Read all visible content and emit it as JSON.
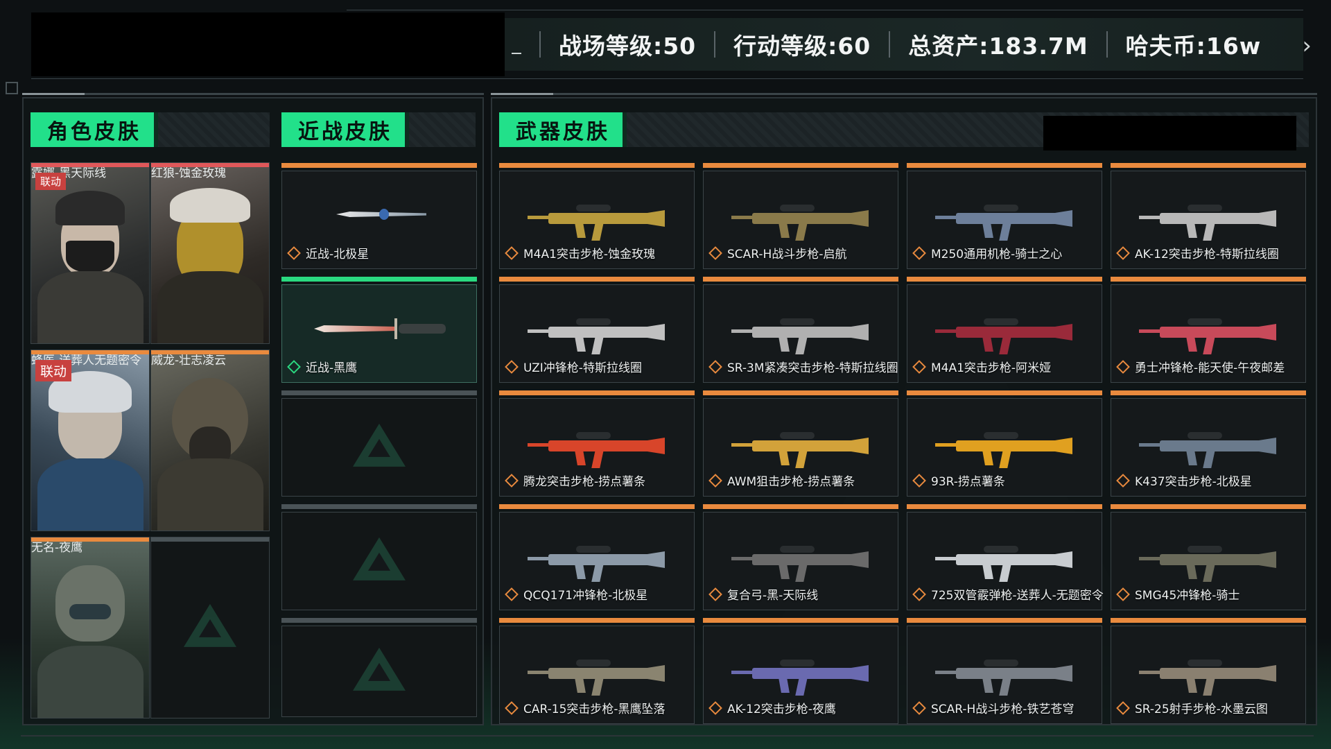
{
  "stats": {
    "battlefield_level": "战场等级:50",
    "operation_level": "行动等级:60",
    "total_assets": "总资产:183.7M",
    "hafcoin": "哈夫币:16w"
  },
  "sections": {
    "character": "角色皮肤",
    "melee": "近战皮肤",
    "weapon": "武器皮肤"
  },
  "characters": [
    {
      "name": "露娜-黑天际线",
      "tag": "联动"
    },
    {
      "name": "红狼-蚀金玫瑰",
      "tag": ""
    },
    {
      "name": "蜂医-送葬人无题密令",
      "tag": "联动"
    },
    {
      "name": "威龙-壮志凌云",
      "tag": ""
    },
    {
      "name": "无名-夜鹰",
      "tag": ""
    }
  ],
  "melee": [
    {
      "name": "近战-北极星"
    },
    {
      "name": "近战-黑鹰"
    }
  ],
  "weapons": [
    {
      "name": "M4A1突击步枪-蚀金玫瑰",
      "color": "#b89a3c"
    },
    {
      "name": "SCAR-H战斗步枪-启航",
      "color": "#8a7a4a"
    },
    {
      "name": "M250通用机枪-骑士之心",
      "color": "#6d7f9a"
    },
    {
      "name": "AK-12突击步枪-特斯拉线圈",
      "color": "#b8b8b8"
    },
    {
      "name": "UZI冲锋枪-特斯拉线圈",
      "color": "#c0c0c0"
    },
    {
      "name": "SR-3M紧凑突击步枪-特斯拉线圈",
      "color": "#b0b0b0"
    },
    {
      "name": "M4A1突击步枪-阿米娅",
      "color": "#9a2a3a"
    },
    {
      "name": "勇士冲锋枪-能天使-午夜邮差",
      "color": "#c84a5a"
    },
    {
      "name": "腾龙突击步枪-捞点薯条",
      "color": "#d8452a"
    },
    {
      "name": "AWM狙击步枪-捞点薯条",
      "color": "#d2a23a"
    },
    {
      "name": "93R-捞点薯条",
      "color": "#e0a020"
    },
    {
      "name": "K437突击步枪-北极星",
      "color": "#6a7a8c"
    },
    {
      "name": "QCQ171冲锋枪-北极星",
      "color": "#8c9aa8"
    },
    {
      "name": "复合弓-黑-天际线",
      "color": "#6a6a6a"
    },
    {
      "name": "725双管霰弹枪-送葬人-无题密令",
      "color": "#c8ccd0"
    },
    {
      "name": "SMG45冲锋枪-骑士",
      "color": "#6a6a5a"
    },
    {
      "name": "CAR-15突击步枪-黑鹰坠落",
      "color": "#8a8470"
    },
    {
      "name": "AK-12突击步枪-夜鹰",
      "color": "#6a6ab0"
    },
    {
      "name": "SCAR-H战斗步枪-铁艺苍穹",
      "color": "#7a8088"
    },
    {
      "name": "SR-25射手步枪-水墨云图",
      "color": "#8a8070"
    }
  ]
}
